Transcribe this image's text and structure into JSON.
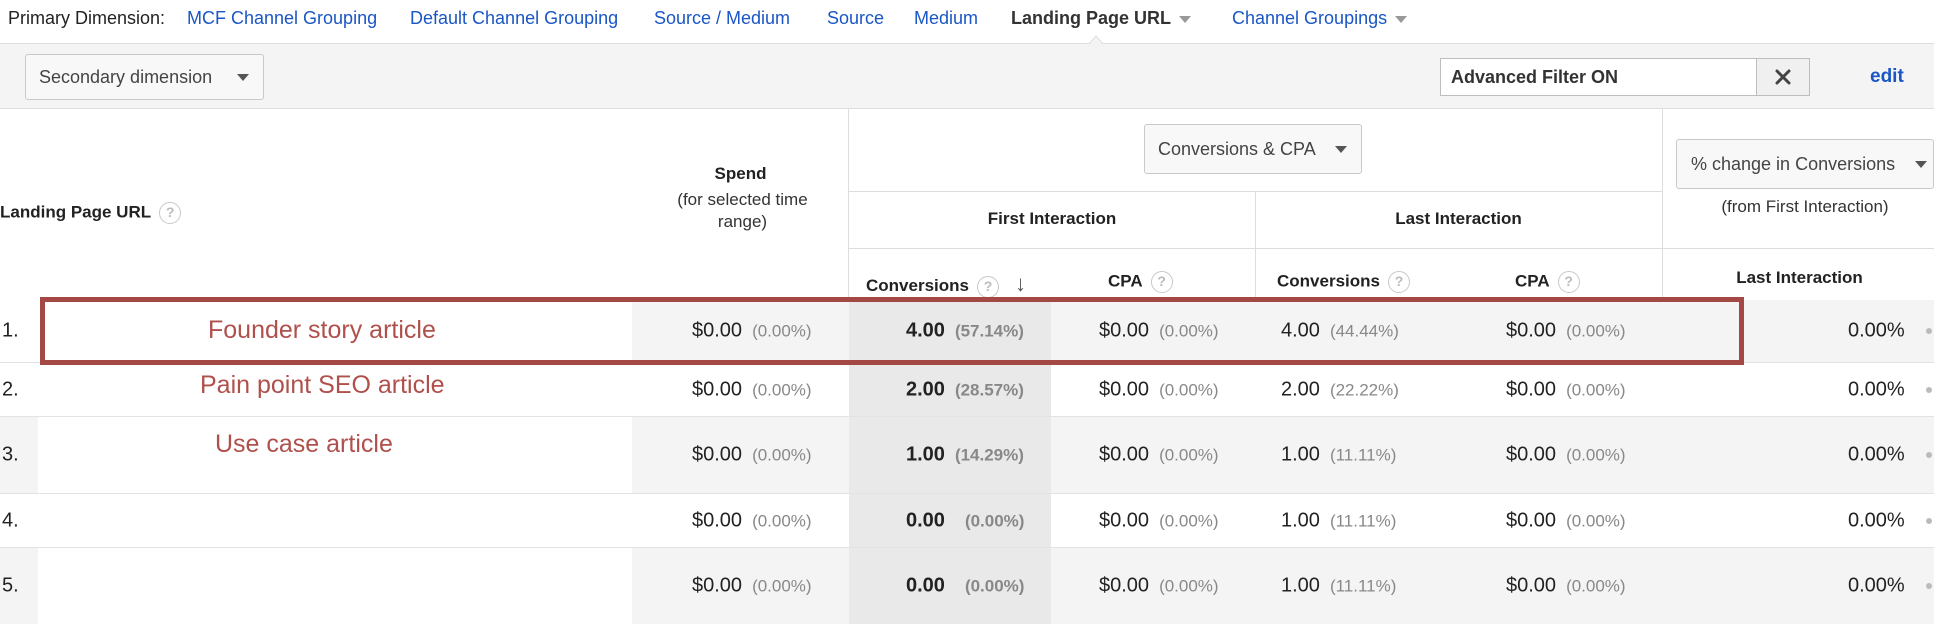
{
  "dimension_bar": {
    "label": "Primary Dimension:",
    "links": [
      "MCF Channel Grouping",
      "Default Channel Grouping",
      "Source / Medium",
      "Source",
      "Medium"
    ],
    "selected": "Landing Page URL",
    "channel_groupings": "Channel Groupings"
  },
  "toolbar": {
    "secondary_dimension": "Secondary dimension",
    "filter_text": "Advanced Filter ON",
    "edit_label": "edit"
  },
  "header": {
    "landing_page_url": "Landing Page URL",
    "spend_title": "Spend",
    "spend_sub": "(for selected time range)",
    "metric_select": "Conversions & CPA",
    "first_interaction": "First Interaction",
    "last_interaction": "Last Interaction",
    "conversions": "Conversions",
    "cpa": "CPA",
    "pct_change_select": "% change in Conversions",
    "pct_change_sub": "(from First Interaction)",
    "last_interaction_col": "Last Interaction",
    "help_glyph": "?",
    "sort_arrow": "↓"
  },
  "annotations": {
    "row1": "Founder story article",
    "row2": "Pain point SEO article",
    "row3": "Use case article"
  },
  "rows": [
    {
      "index": "1.",
      "spend": "$0.00",
      "spend_pct": "(0.00%)",
      "fi_conv": "4.00",
      "fi_conv_pct": "(57.14%)",
      "fi_cpa": "$0.00",
      "fi_cpa_pct": "(0.00%)",
      "li_conv": "4.00",
      "li_conv_pct": "(44.44%)",
      "li_cpa": "$0.00",
      "li_cpa_pct": "(0.00%)",
      "change": "0.00%"
    },
    {
      "index": "2.",
      "spend": "$0.00",
      "spend_pct": "(0.00%)",
      "fi_conv": "2.00",
      "fi_conv_pct": "(28.57%)",
      "fi_cpa": "$0.00",
      "fi_cpa_pct": "(0.00%)",
      "li_conv": "2.00",
      "li_conv_pct": "(22.22%)",
      "li_cpa": "$0.00",
      "li_cpa_pct": "(0.00%)",
      "change": "0.00%"
    },
    {
      "index": "3.",
      "spend": "$0.00",
      "spend_pct": "(0.00%)",
      "fi_conv": "1.00",
      "fi_conv_pct": "(14.29%)",
      "fi_cpa": "$0.00",
      "fi_cpa_pct": "(0.00%)",
      "li_conv": "1.00",
      "li_conv_pct": "(11.11%)",
      "li_cpa": "$0.00",
      "li_cpa_pct": "(0.00%)",
      "change": "0.00%"
    },
    {
      "index": "4.",
      "spend": "$0.00",
      "spend_pct": "(0.00%)",
      "fi_conv": "0.00",
      "fi_conv_pct": "(0.00%)",
      "fi_cpa": "$0.00",
      "fi_cpa_pct": "(0.00%)",
      "li_conv": "1.00",
      "li_conv_pct": "(11.11%)",
      "li_cpa": "$0.00",
      "li_cpa_pct": "(0.00%)",
      "change": "0.00%"
    },
    {
      "index": "5.",
      "spend": "$0.00",
      "spend_pct": "(0.00%)",
      "fi_conv": "0.00",
      "fi_conv_pct": "(0.00%)",
      "fi_cpa": "$0.00",
      "fi_cpa_pct": "(0.00%)",
      "li_conv": "1.00",
      "li_conv_pct": "(11.11%)",
      "li_cpa": "$0.00",
      "li_cpa_pct": "(0.00%)",
      "change": "0.00%"
    }
  ],
  "colors": {
    "link": "#1a56c5",
    "annotation": "#b0504c",
    "highlight_box": "#a44845"
  }
}
